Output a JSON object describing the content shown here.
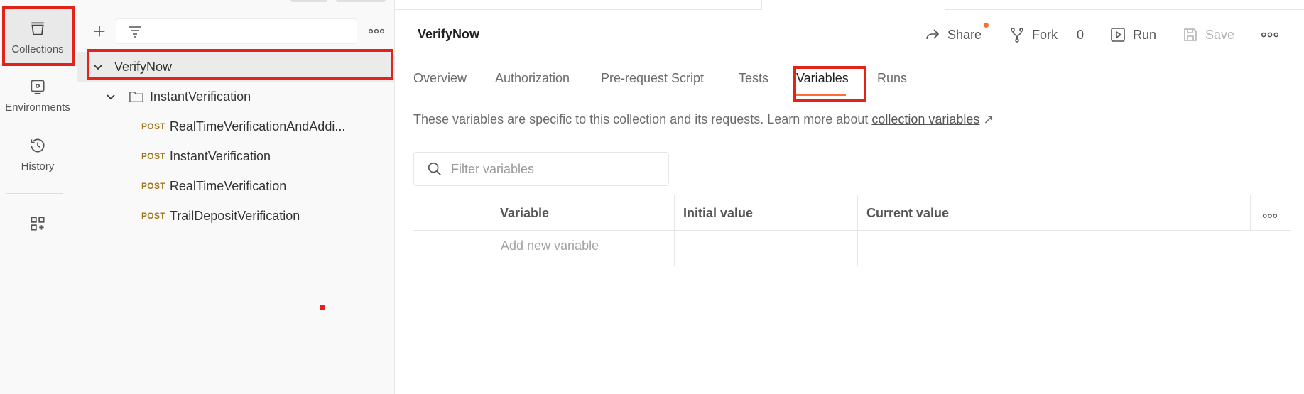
{
  "rail": {
    "items": [
      {
        "label": "Collections",
        "icon": "collections-icon",
        "active": true
      },
      {
        "label": "Environments",
        "icon": "environments-icon",
        "active": false
      },
      {
        "label": "History",
        "icon": "history-icon",
        "active": false
      }
    ],
    "bottom_icon": "configure-workspace-icon"
  },
  "sidebar": {
    "tree": {
      "collection": "VerifyNow",
      "folder": "InstantVerification",
      "requests": [
        {
          "method": "POST",
          "name": "RealTimeVerificationAndAddi..."
        },
        {
          "method": "POST",
          "name": "InstantVerification"
        },
        {
          "method": "POST",
          "name": "RealTimeVerification"
        },
        {
          "method": "POST",
          "name": "TrailDepositVerification"
        }
      ]
    }
  },
  "header": {
    "title": "VerifyNow",
    "share": "Share",
    "fork": "Fork",
    "fork_count": "0",
    "run": "Run",
    "save": "Save"
  },
  "tabs": [
    "Overview",
    "Authorization",
    "Pre-request Script",
    "Tests",
    "Variables",
    "Runs"
  ],
  "active_tab": "Variables",
  "description": {
    "text": "These variables are specific to this collection and its requests. Learn more about ",
    "link": "collection variables",
    "arrow": "↗"
  },
  "filter": {
    "placeholder": "Filter variables"
  },
  "table": {
    "columns": [
      "Variable",
      "Initial value",
      "Current value"
    ],
    "add_placeholder": "Add new variable"
  },
  "colors": {
    "accent": "#ff6c37",
    "annotation": "#e2231a",
    "method_post": "#a0761b"
  }
}
